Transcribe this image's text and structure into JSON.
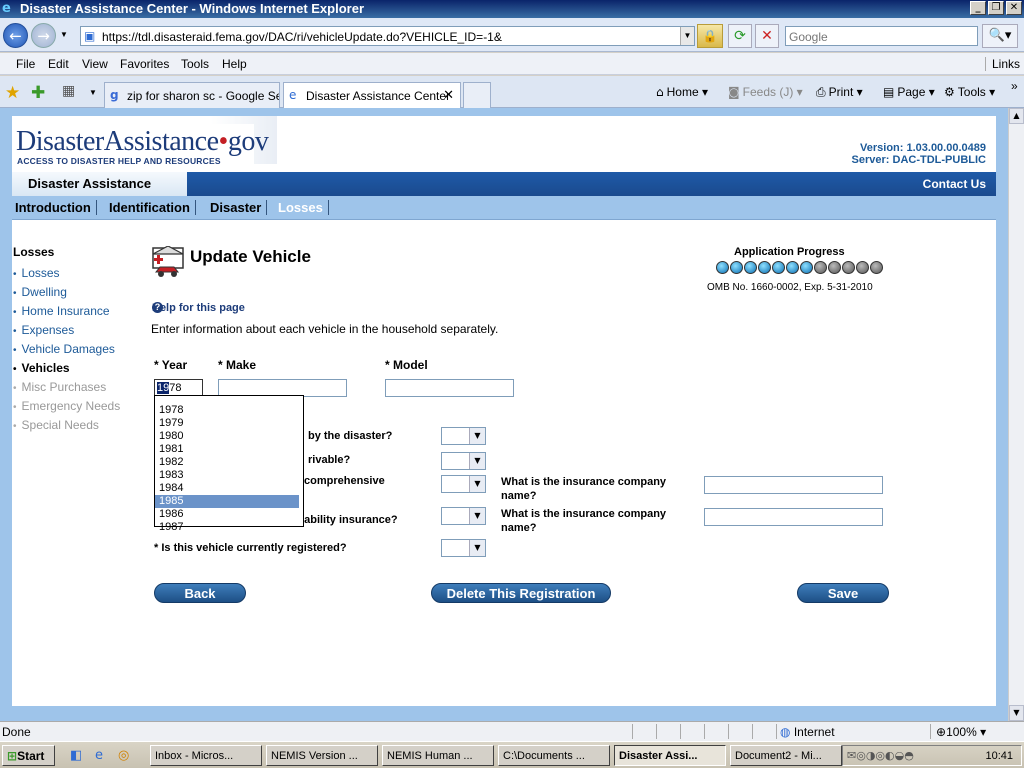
{
  "window": {
    "title": "Disaster Assistance Center - Windows Internet Explorer"
  },
  "address": {
    "url": "https://tdl.disasteraid.fema.gov/DAC/ri/vehicleUpdate.do?VEHICLE_ID=-1&",
    "search_placeholder": "Google"
  },
  "menu": [
    "File",
    "Edit",
    "View",
    "Favorites",
    "Tools",
    "Help"
  ],
  "links_label": "Links",
  "tabs": [
    {
      "label": "zip for sharon sc - Google Se..."
    },
    {
      "label": "Disaster Assistance Center"
    }
  ],
  "commands": {
    "home": "Home",
    "feeds": "Feeds (J)",
    "print": "Print",
    "page": "Page",
    "tools": "Tools"
  },
  "site": {
    "logo_main": "DisasterAssistance",
    "logo_dot": "•",
    "logo_gov": "gov",
    "logo_tag": "ACCESS TO DISASTER HELP AND RESOURCES",
    "version": "Version: 1.03.00.00.0489",
    "server": "Server: DAC-TDL-PUBLIC",
    "section_tab": "Disaster Assistance",
    "contact": "Contact Us",
    "nav": [
      "Introduction",
      "Identification",
      "Disaster",
      "Losses"
    ]
  },
  "left_nav": {
    "title": "Losses",
    "items": [
      {
        "label": "Losses"
      },
      {
        "label": "Dwelling"
      },
      {
        "label": "Home Insurance"
      },
      {
        "label": "Expenses"
      },
      {
        "label": "Vehicle Damages"
      },
      {
        "label": "Vehicles"
      },
      {
        "label": "Misc Purchases"
      },
      {
        "label": "Emergency Needs"
      },
      {
        "label": "Special Needs"
      }
    ]
  },
  "main": {
    "title": "Update Vehicle",
    "help": "Help for this page",
    "intro": "Enter information about each vehicle in the household separately.",
    "progress_title": "Application Progress",
    "progress_completed": 7,
    "progress_total": 12,
    "omb": "OMB No. 1660-0002, Exp. 5-31-2010",
    "year_label": "* Year",
    "make_label": "* Make",
    "model_label": "* Model",
    "year_value_sel": "19",
    "year_value_rest": "78",
    "q_damaged": "by the disaster?",
    "q_drivable": "rivable?",
    "q_comprehensive": "comprehensive",
    "q_liability": "liability insurance?",
    "q_registered": "* Is this vehicle currently registered?",
    "ins_company_1": "What is the insurance company name?",
    "ins_company_2": "What is the insurance company name?",
    "year_options": [
      "1978",
      "1979",
      "1980",
      "1981",
      "1982",
      "1983",
      "1984",
      "1985",
      "1986",
      "1987"
    ],
    "year_highlighted": "1985",
    "back": "Back",
    "delete": "Delete This Registration",
    "save": "Save"
  },
  "status": {
    "done": "Done",
    "zone": "Internet",
    "zoom": "100%"
  },
  "taskbar": {
    "start": "Start",
    "items": [
      {
        "label": "Inbox - Micros..."
      },
      {
        "label": "NEMIS Version ..."
      },
      {
        "label": "NEMIS Human ..."
      },
      {
        "label": "C:\\Documents ..."
      },
      {
        "label": "Disaster Assi..."
      },
      {
        "label": "Document2 - Mi..."
      }
    ],
    "clock": "10:41"
  }
}
